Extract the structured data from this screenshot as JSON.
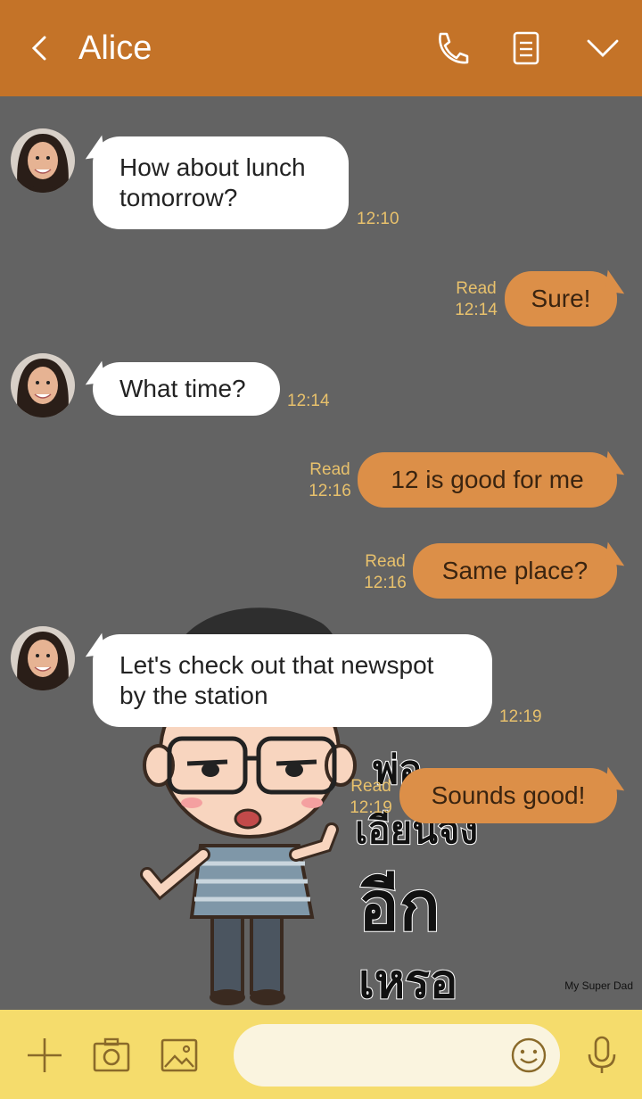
{
  "header": {
    "title": "Alice"
  },
  "messages": [
    {
      "dir": "in",
      "text": "How about lunch tomorrow?",
      "time": "12:10"
    },
    {
      "dir": "out",
      "text": "Sure!",
      "read": "Read",
      "time": "12:14"
    },
    {
      "dir": "in",
      "text": "What time?",
      "time": "12:14"
    },
    {
      "dir": "out",
      "text": "12 is good for me",
      "read": "Read",
      "time": "12:16"
    },
    {
      "dir": "out",
      "text": "Same place?",
      "read": "Read",
      "time": "12:16"
    },
    {
      "dir": "in",
      "text": "Let's check out that newspot by the station",
      "time": "12:19"
    },
    {
      "dir": "out",
      "text": "Sounds good!",
      "read": "Read",
      "time": "12:19"
    }
  ],
  "sticker": {
    "line1": "พ่อ",
    "line2": "เอียนจัง",
    "line3": "อีก",
    "line4": "เหรอ",
    "credit": "My Super Dad"
  },
  "colors": {
    "header": "#c47328",
    "background": "#636363",
    "out_bubble": "#dc8f48",
    "time": "#e8c16c",
    "bottom_bar": "#f5dc6c"
  },
  "icons": [
    "back-chevron-icon",
    "phone-icon",
    "note-icon",
    "chevron-down-icon",
    "plus-icon",
    "camera-icon",
    "image-icon",
    "smile-icon",
    "mic-icon"
  ]
}
